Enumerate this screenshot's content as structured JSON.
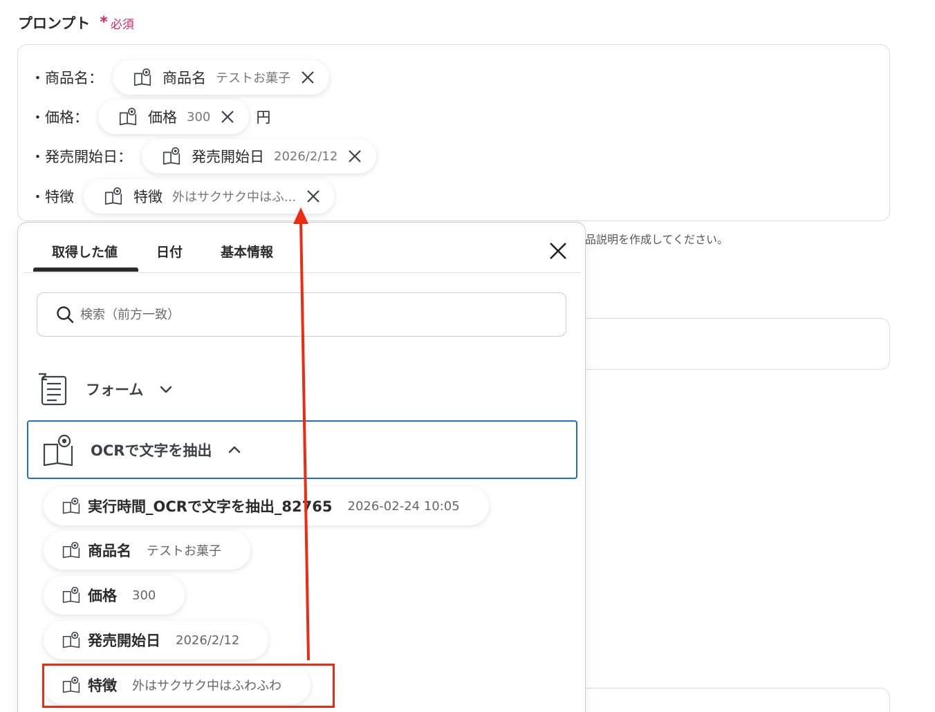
{
  "field": {
    "label": "プロンプト",
    "required_mark": "*",
    "required_text": "必須"
  },
  "prompt_lines": [
    {
      "label": "・商品名：",
      "chip_name": "商品名",
      "chip_value": "テストお菓子",
      "suffix": ""
    },
    {
      "label": "・価格：",
      "chip_name": "価格",
      "chip_value": "300",
      "suffix": "円"
    },
    {
      "label": "・発売開始日：",
      "chip_name": "発売開始日",
      "chip_value": "2026/2/12",
      "suffix": ""
    },
    {
      "label": "・特徴",
      "chip_name": "特徴",
      "chip_value": "外はサクサク中はふ...",
      "suffix": ""
    }
  ],
  "help_text": "品説明を作成してください。",
  "popup": {
    "tabs": [
      "取得した値",
      "日付",
      "基本情報"
    ],
    "active_tab": "取得した値",
    "search_placeholder": "検索（前方一致）",
    "groups": [
      {
        "name": "フォーム",
        "icon": "form-icon",
        "expanded": false
      },
      {
        "name": "OCRで文字を抽出",
        "icon": "ocr-book-icon",
        "expanded": true
      }
    ],
    "items": [
      {
        "name": "実行時間_OCRで文字を抽出_82765",
        "value": "2026-02-24 10:05"
      },
      {
        "name": "商品名",
        "value": "テストお菓子"
      },
      {
        "name": "価格",
        "value": "300"
      },
      {
        "name": "発売開始日",
        "value": "2026/2/12"
      },
      {
        "name": "特徴",
        "value": "外はサクサク中はふわふわ"
      }
    ]
  },
  "annotation": {
    "highlight_color": "#ee2a10",
    "accent_color": "#1c6fd1"
  }
}
